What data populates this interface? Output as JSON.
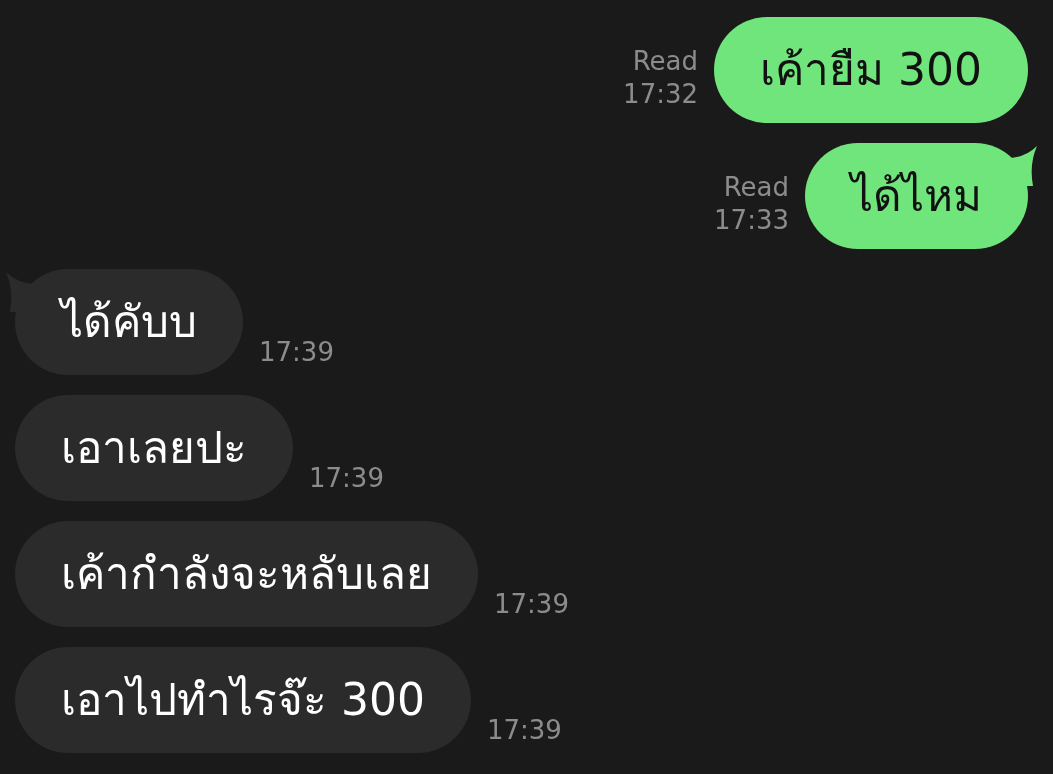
{
  "messages": [
    {
      "kind": "sent",
      "text": "เค้ายืม 300",
      "receipt": "Read",
      "time": "17:32",
      "tail": false
    },
    {
      "kind": "sent",
      "text": "ได้ไหม",
      "receipt": "Read",
      "time": "17:33",
      "tail": true
    },
    {
      "kind": "received",
      "text": "ได้คับบ",
      "time": "17:39",
      "tail": true
    },
    {
      "kind": "received",
      "text": "เอาเลยปะ",
      "time": "17:39",
      "tail": false
    },
    {
      "kind": "received",
      "text": "เค้ากำลังจะหลับเลย",
      "time": "17:39",
      "tail": false
    },
    {
      "kind": "received",
      "text": "เอาไปทำไรจ๊ะ 300",
      "time": "17:39",
      "tail": false
    }
  ]
}
